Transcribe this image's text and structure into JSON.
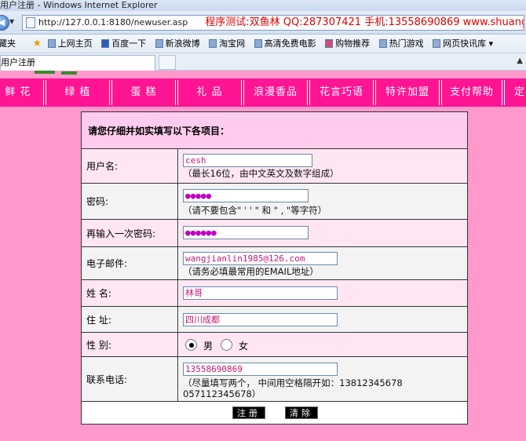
{
  "window": {
    "title": "用户注册 - Windows Internet Explorer"
  },
  "addressbar": {
    "url": "http://127.0.0.1:8180/newuser.asp",
    "promo": "程序测试:双鱼林 QQ:287307421 手机:13558690869 www.shuangyulin.com"
  },
  "favorites": {
    "label": "藏夹",
    "items": [
      {
        "label": "上网主页"
      },
      {
        "label": "百度一下"
      },
      {
        "label": "新浪微博"
      },
      {
        "label": "淘宝网"
      },
      {
        "label": "高清免费电影"
      },
      {
        "label": "购物推荐"
      },
      {
        "label": "热门游戏"
      },
      {
        "label": "网页快讯库 ▾"
      }
    ]
  },
  "tab": {
    "label": "用户注册"
  },
  "nav": {
    "items": [
      {
        "label": "鲜 花"
      },
      {
        "label": "绿 植"
      },
      {
        "label": "蛋 糕"
      },
      {
        "label": "礼 品"
      },
      {
        "label": "浪漫香品"
      },
      {
        "label": "花言巧语"
      },
      {
        "label": "特许加盟"
      },
      {
        "label": "支付帮助"
      },
      {
        "label": "定"
      }
    ]
  },
  "form": {
    "heading": "请您仔细并如实填写以下各项目：",
    "username": {
      "label": "用户名:",
      "value": "cesh",
      "hint": "（最长16位，由中文英文及数字组成）"
    },
    "password": {
      "label": "密码:",
      "value": "●●●●●",
      "hint": "（请不要包含\" ' ' \" 和 \" , \"等字符）"
    },
    "password_confirm": {
      "label": "再输入一次密码:",
      "value": "●●●●●●"
    },
    "email": {
      "label": "电子邮件:",
      "value": "wangjianlin1985@126.com",
      "hint": "（请务必填最常用的EMAIL地址）"
    },
    "name": {
      "label": "姓  名:",
      "value": "林哥"
    },
    "address": {
      "label": "住  址:",
      "value": "四川成都"
    },
    "gender": {
      "label": "性  别:",
      "options": [
        "男",
        "女"
      ],
      "selected": "男"
    },
    "phone": {
      "label": "联系电话:",
      "value": "13558690869",
      "hint_line1": "（尽量填写两个， 中间用空格隔开如：13812345678",
      "hint_line2": "057112345678）"
    },
    "submit_label": "注册",
    "reset_label": "清除"
  }
}
